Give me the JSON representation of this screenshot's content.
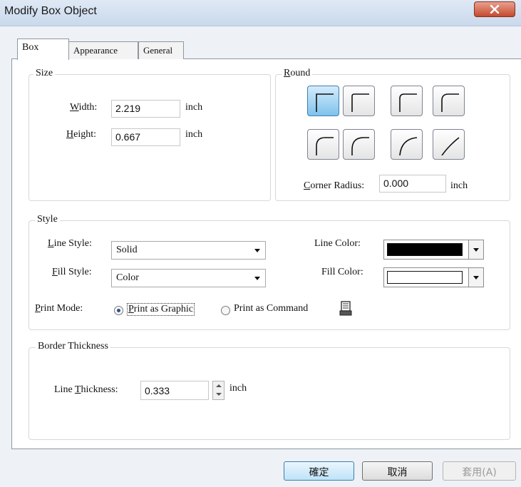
{
  "window": {
    "title": "Modify Box Object"
  },
  "tabs": [
    {
      "label": "Box"
    },
    {
      "label": "Appearance"
    },
    {
      "label": "General"
    }
  ],
  "size_group": {
    "label": "Size",
    "width_label": "Width:",
    "width_value": "2.219",
    "width_unit": "inch",
    "height_label": "Height:",
    "height_value": "0.667",
    "height_unit": "inch"
  },
  "round_group": {
    "label": "Round",
    "corner_radius_label": "Corner Radius:",
    "corner_radius_value": "0.000",
    "corner_radius_unit": "inch",
    "selected_preset": 0,
    "preset_count": 8
  },
  "style_group": {
    "label": "Style",
    "line_style_label": "Line Style:",
    "line_style_value": "Solid",
    "fill_style_label": "Fill Style:",
    "fill_style_value": "Color",
    "line_color_label": "Line Color:",
    "line_color": "#000000",
    "fill_color_label": "Fill Color:",
    "fill_color": "#ffffff",
    "print_mode_label": "Print Mode:",
    "print_as_graphic": "Print as Graphic",
    "print_as_command": "Print as Command",
    "selected_print_mode": "graphic"
  },
  "border_group": {
    "label": "Border Thickness",
    "line_thickness_label": "Line Thickness:",
    "line_thickness_value": "0.333",
    "line_thickness_unit": "inch"
  },
  "buttons": {
    "ok": "確定",
    "cancel": "取消",
    "apply": "套用(A)"
  }
}
